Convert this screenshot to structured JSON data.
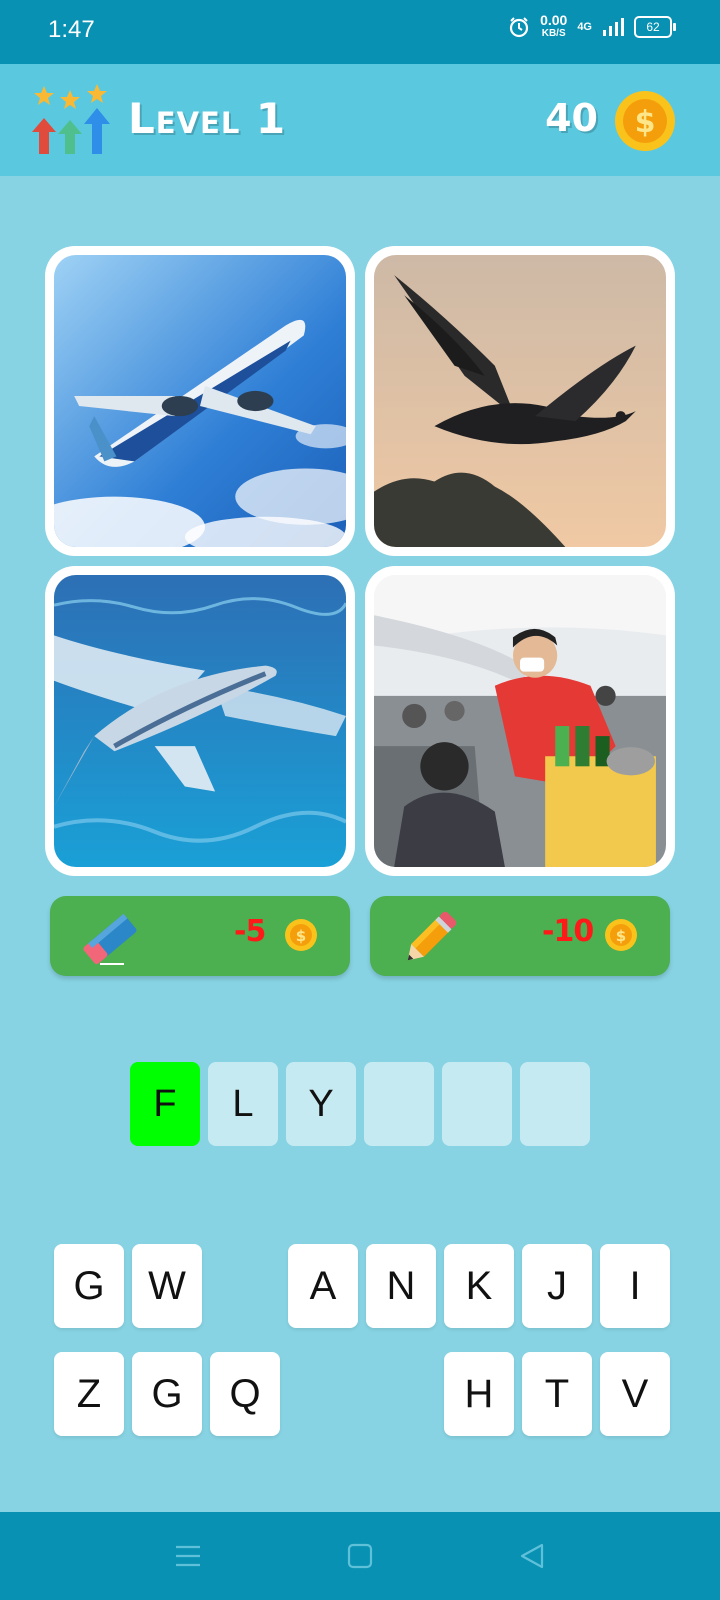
{
  "status": {
    "time": "1:47",
    "speed_value": "0.00",
    "speed_unit": "KB/S",
    "network": "4G",
    "battery": "62"
  },
  "header": {
    "level_title": "Level 1",
    "coins": "40"
  },
  "images": [
    {
      "name": "airplane"
    },
    {
      "name": "bird"
    },
    {
      "name": "flying-fish"
    },
    {
      "name": "flight-attendant"
    }
  ],
  "hints": {
    "eraser_cost": "-5",
    "pencil_cost": "-10"
  },
  "answer": {
    "slots": [
      "F",
      "L",
      "Y",
      "",
      "",
      ""
    ]
  },
  "keyboard": {
    "row1": [
      "G",
      "W",
      "",
      "A",
      "N",
      "K",
      "J",
      "I"
    ],
    "row2": [
      "Z",
      "G",
      "Q",
      "",
      "",
      "H",
      "T",
      "V"
    ]
  },
  "colors": {
    "background": "#87d3e3",
    "header": "#5ac9e0",
    "status_bar": "#0891b2",
    "hint_button": "#4caf50",
    "cost_text": "#ff1a1a",
    "correct_slot": "#00ff00"
  }
}
